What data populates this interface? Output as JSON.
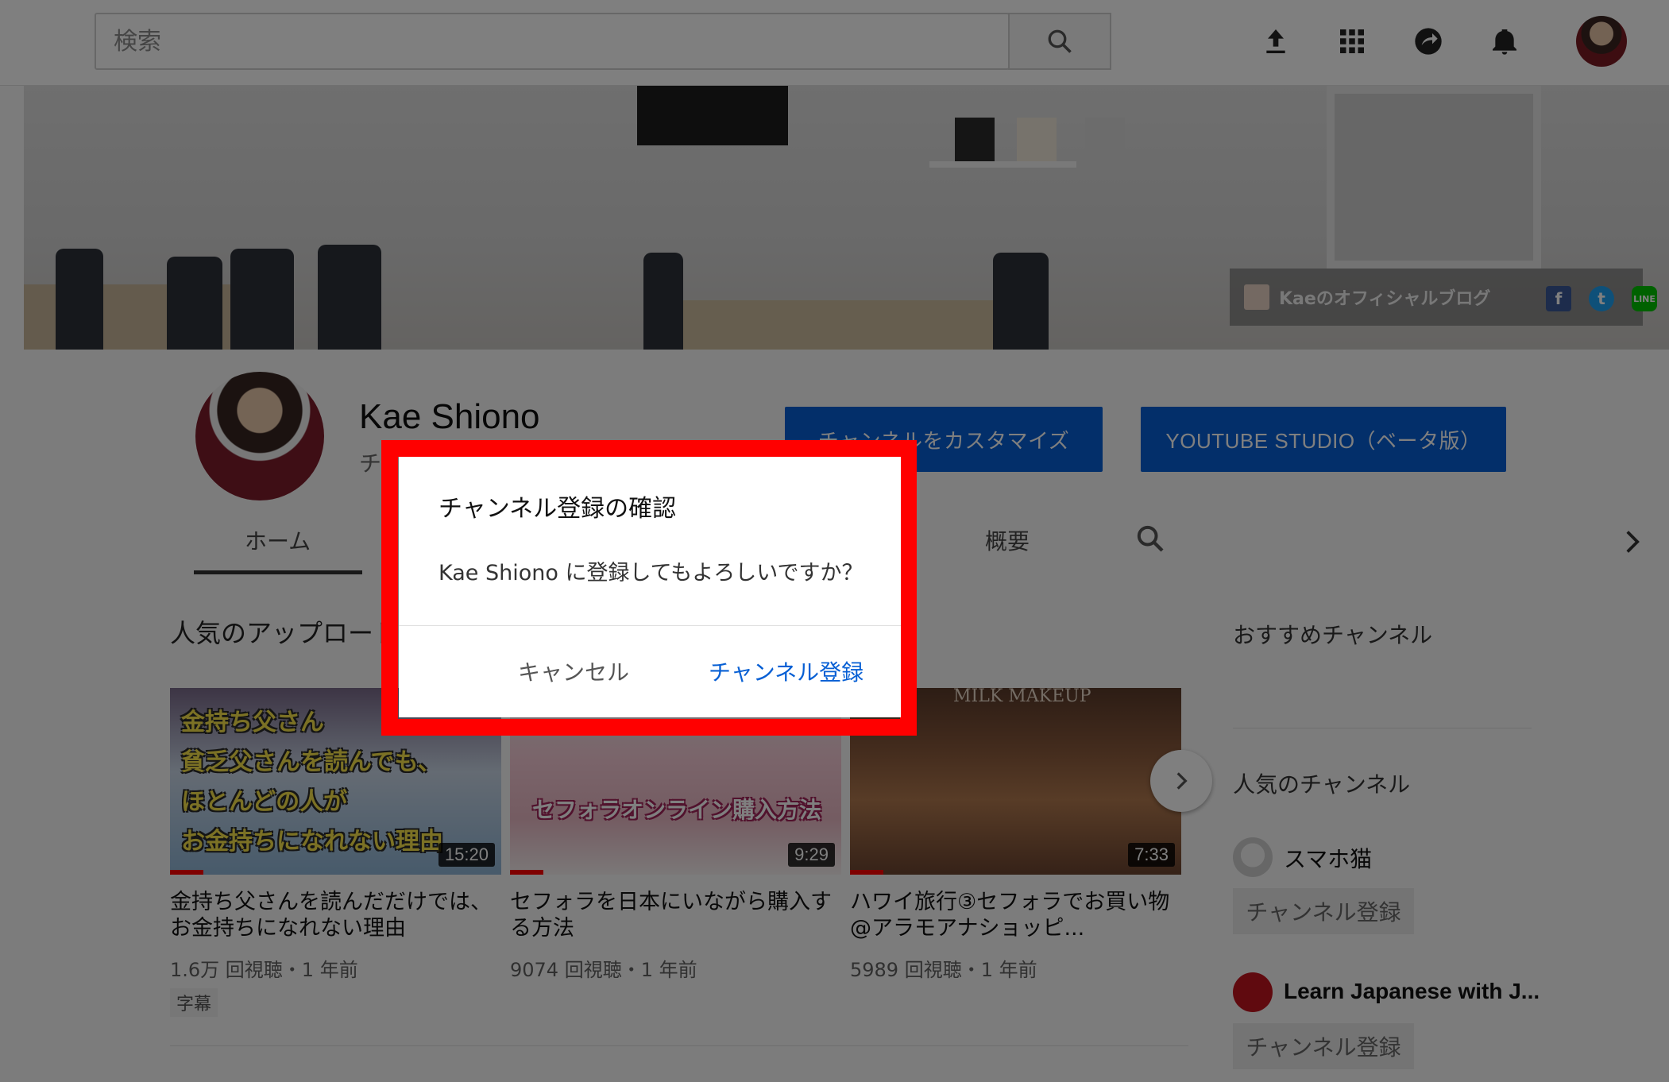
{
  "header": {
    "search_placeholder": "検索",
    "icons": [
      "search-icon",
      "upload-icon",
      "apps-icon",
      "share-icon",
      "bell-icon",
      "avatar"
    ]
  },
  "banner": {
    "blog_link_label": "Kaeのオフィシャルブログ",
    "social_links": [
      "facebook-icon",
      "twitter-icon",
      "line-icon"
    ]
  },
  "channel": {
    "name": "Kae Shiono",
    "subtitle": "チ",
    "customize_button": "チャンネルをカスタマイズ",
    "studio_button": "YOUTUBE STUDIO（ベータ版）"
  },
  "tabs": {
    "home": "ホーム",
    "about": "概要"
  },
  "section": {
    "title": "人気のアップロード"
  },
  "videos": [
    {
      "overlay_lines": [
        "金持ち父さん",
        "貧乏父さんを読んでも、",
        "ほとんどの人が",
        "お金持ちになれない理由"
      ],
      "duration": "15:20",
      "progress": 0.1,
      "title": "金持ち父さんを読んだだけでは、お金持ちになれない理由",
      "meta": "1.6万 回視聴・1 年前",
      "badge": "字幕"
    },
    {
      "overlay_lines": [
        "セフォラオンライン購入方法"
      ],
      "duration": "9:29",
      "progress": 0.1,
      "title": "セフォラを日本にいながら購入する方法",
      "meta": "9074 回視聴・1 年前"
    },
    {
      "overlay_lines": [
        "MILK MAKEUP"
      ],
      "duration": "7:33",
      "progress": 0.1,
      "title": "ハワイ旅行③セフォラでお買い物@アラモアナショッピ...",
      "meta": "5989 回視聴・1 年前"
    }
  ],
  "sidebar": {
    "recommended_heading": "おすすめチャンネル",
    "popular_heading": "人気のチャンネル",
    "channels": [
      {
        "name": "スマホ猫",
        "button": "チャンネル登録"
      },
      {
        "name": "Learn Japanese with J...",
        "button": "チャンネル登録"
      }
    ]
  },
  "dialog": {
    "title": "チャンネル登録の確認",
    "message": "Kae Shiono に登録してもよろしいですか？",
    "cancel": "キャンセル",
    "confirm": "チャンネル登録"
  },
  "colors": {
    "accent_blue": "#065fd4",
    "highlight_red": "#ff0000",
    "overlay": "rgba(0,0,0,0.5)"
  }
}
